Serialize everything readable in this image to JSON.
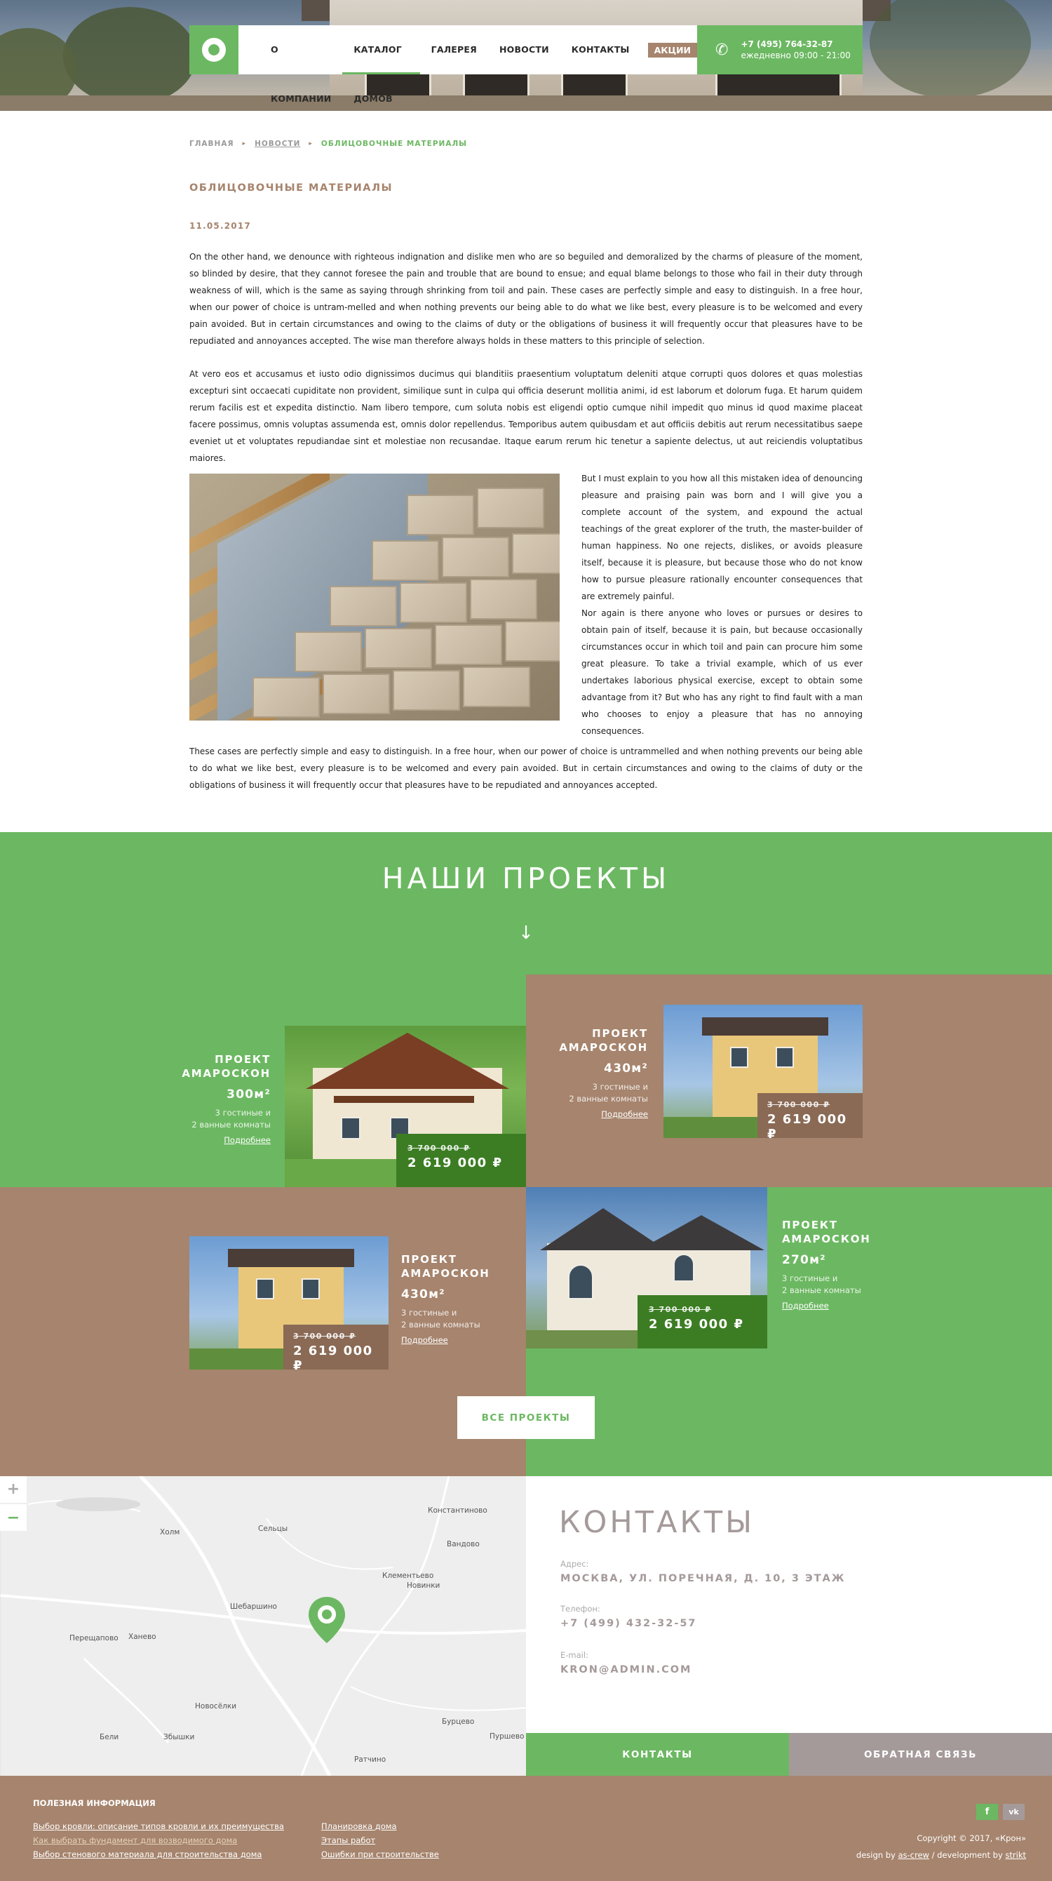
{
  "header": {
    "menu": [
      {
        "label": "О КОМПАНИИ",
        "active": false
      },
      {
        "label": "КАТАЛОГ ДОМОВ",
        "active": true
      },
      {
        "label": "ГАЛЕРЕЯ",
        "active": false
      },
      {
        "label": "НОВОСТИ",
        "active": false
      },
      {
        "label": "КОНТАКТЫ",
        "active": false
      }
    ],
    "promo_label": "АКЦИИ",
    "phone": "+7 (495) 764-32-87",
    "hours": "ежедневно 09:00 - 21:00",
    "icons": {
      "logo": "ring-logo-icon",
      "phone": "phone-icon"
    }
  },
  "breadcrumb": {
    "home": "ГЛАВНАЯ",
    "news": "НОВОСТИ",
    "current": "ОБЛИЦОВОЧНЫЕ МАТЕРИАЛЫ"
  },
  "article": {
    "title": "ОБЛИЦОВОЧНЫЕ МАТЕРИАЛЫ",
    "date": "11.05.2017",
    "p1": "On the other hand, we denounce with righteous indignation and dislike men who are so beguiled and demoralized by the charms of pleasure of the moment, so blinded by desire, that they cannot foresee the pain and trouble that are bound to ensue; and equal blame belongs to those who fail in their duty through weakness of will, which is the same as saying through shrinking from toil and pain. These cases are perfectly simple and easy to distinguish. In a free hour, when our power of choice is untram-melled and when nothing prevents our being able to do what we like best, every pleasure is to be welcomed and every pain avoided. But in certain circumstances and owing to the claims of duty or the obligations of business it will frequently occur that pleasures have to be repudiated and annoyances accepted. The wise man therefore always holds in these matters to this principle of selection.",
    "p2": "At vero eos et accusamus et iusto odio dignissimos ducimus qui blanditiis praesentium voluptatum deleniti atque corrupti quos dolores et quas molestias excepturi sint occaecati cupiditate non provident, similique sunt in culpa qui officia deserunt mollitia animi, id est laborum et dolorum fuga. Et harum quidem rerum facilis est et expedita distinctio. Nam libero tempore, cum soluta nobis est eligendi optio cumque nihil impedit quo minus id quod maxime placeat facere possimus, omnis voluptas assumenda est, omnis dolor repellendus. Temporibus autem quibusdam et aut officiis debitis aut rerum necessitatibus saepe eveniet ut et voluptates repudiandae sint et molestiae non recusandae. Itaque earum rerum hic tenetur a sapiente delectus, ut aut reiciendis voluptatibus maiores.",
    "p3": "But I must explain to you how all this mistaken idea of denouncing pleasure and praising pain was born and I will give you a complete account of the system, and expound the actual teachings of the great explorer of the truth, the master-builder of human happiness. No one rejects, dislikes, or avoids pleasure itself, because it is pleasure, but because those who do not know how to pursue pleasure rationally encounter consequences that are extremely painful.",
    "p4": "Nor again is there anyone who loves or pursues or desires to obtain pain of itself, because it is pain, but because occasionally circumstances occur in which toil and pain can procure him some great pleasure. To take a trivial example, which of us ever undertakes laborious physical exercise, except to obtain some advantage from it? But who has any right to find fault with a man who chooses to enjoy a pleasure that has no annoying consequences.",
    "p5": "These cases are perfectly simple and easy to distinguish. In a free hour, when our power of choice is untrammelled and when nothing prevents our being able to do what we like best, every pleasure is to be welcomed and every pain avoided. But in certain circumstances and owing to the claims of duty or the obligations of business it will frequently occur that pleasures have to be repudiated and annoyances accepted."
  },
  "projects": {
    "heading": "НАШИ ПРОЕКТЫ",
    "arrow": "↓",
    "all_button": "ВСЕ ПРОЕКТЫ",
    "items": [
      {
        "name": "ПРОЕКТ АМАРОСКОН",
        "area": "300м²",
        "desc1": "3 гостиные и",
        "desc2": "2 ванные комнаты",
        "more": "Подробнее",
        "old_price": "3 700 000 ₽",
        "price": "2 619 000 ₽"
      },
      {
        "name": "ПРОЕКТ АМАРОСКОН",
        "area": "430м²",
        "desc1": "3 гостиные и",
        "desc2": "2 ванные комнаты",
        "more": "Подробнее",
        "old_price": "3 700 000 ₽",
        "price": "2 619 000 ₽"
      },
      {
        "name": "ПРОЕКТ АМАРОСКОН",
        "area": "430м²",
        "desc1": "3 гостиные и",
        "desc2": "2 ванные комнаты",
        "more": "Подробнее",
        "old_price": "3 700 000 ₽",
        "price": "2 619 000 ₽"
      },
      {
        "name": "ПРОЕКТ АМАРОСКОН",
        "area": "270м²",
        "desc1": "3 гостиные и",
        "desc2": "2 ванные комнаты",
        "more": "Подробнее",
        "old_price": "3 700 000 ₽",
        "price": "2 619 000 ₽"
      }
    ]
  },
  "map": {
    "zoom_in": "+",
    "zoom_out": "−",
    "places": [
      "Константиново",
      "Сельцы",
      "Холм",
      "Вандово",
      "Клементьево",
      "Новинки",
      "Шебаршино",
      "Перещапово",
      "Ханево",
      "Новосёлки",
      "Бурцево",
      "Пуршево",
      "Бели",
      "Збышки",
      "Ратчино"
    ]
  },
  "contacts": {
    "heading": "КОНТАКТЫ",
    "address_label": "Адрес:",
    "address": "МОСКВА, УЛ. ПОРЕЧНАЯ, Д. 10, 3 ЭТАЖ",
    "phone_label": "Телефон:",
    "phone": "+7 (499) 432-32-57",
    "email_label": "E-mail:",
    "email": "KRON@ADMIN.COM",
    "btn_contacts": "КОНТАКТЫ",
    "btn_feedback": "ОБРАТНАЯ СВЯЗЬ"
  },
  "footer": {
    "heading": "ПОЛЕЗНАЯ ИНФОРМАЦИЯ",
    "links_col1": [
      "Выбор кровли: описание типов кровли и их преимущества",
      "Как выбрать фундамент для возводимого дома",
      "Выбор стенового материала для строительства дома"
    ],
    "links_col2": [
      "Планировка дома",
      "Этапы работ",
      "Ошибки при строительстве"
    ],
    "social": {
      "fb": "f",
      "vk": "vk"
    },
    "copyright": "Copyright ©  2017, «Крон»",
    "design_prefix": "design by ",
    "design_by": "as-crew",
    "dev_prefix": " / development by ",
    "dev_by": "strikt"
  },
  "colors": {
    "green": "#6cb862",
    "brown": "#a6846d",
    "dark_green": "#3c7d24"
  }
}
